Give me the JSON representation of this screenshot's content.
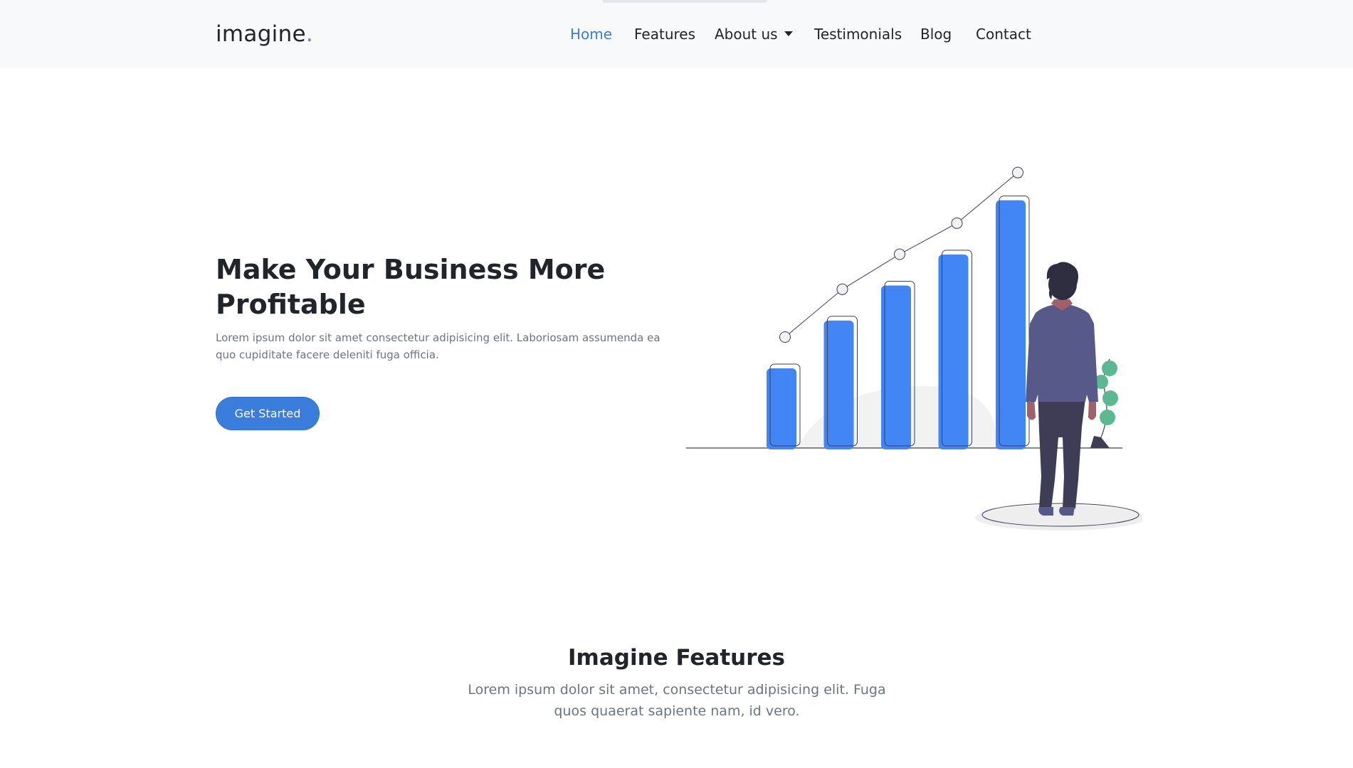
{
  "brand": {
    "name": "imagine",
    "dot": "."
  },
  "nav": {
    "items": [
      {
        "label": "Home",
        "active": true
      },
      {
        "label": "Features"
      },
      {
        "label": "About us",
        "dropdown": true
      },
      {
        "label": "Testimonials"
      },
      {
        "label": "Blog"
      },
      {
        "label": "Contact"
      }
    ]
  },
  "hero": {
    "title": "Make Your Business More Profitable",
    "text": "Lorem ipsum dolor sit amet consectetur adipisicing elit. Laboriosam assumenda ea quo cupiditate facere deleniti fuga officia.",
    "button": "Get Started"
  },
  "illustration": {
    "icon": "growth-chart-illustration",
    "bar_values": [
      1,
      1.6,
      2.04,
      2.43,
      3.11
    ]
  },
  "features": {
    "title": "Imagine Features",
    "text": "Lorem ipsum dolor sit amet, consectetur adipisicing elit. Fuga quos quaerat sapiente nam, id vero."
  },
  "colors": {
    "accent": "#3b7ddd",
    "bar": "#4285f4",
    "suit": "#575a88",
    "pants": "#3f3d56",
    "plant": "#5bb891"
  }
}
